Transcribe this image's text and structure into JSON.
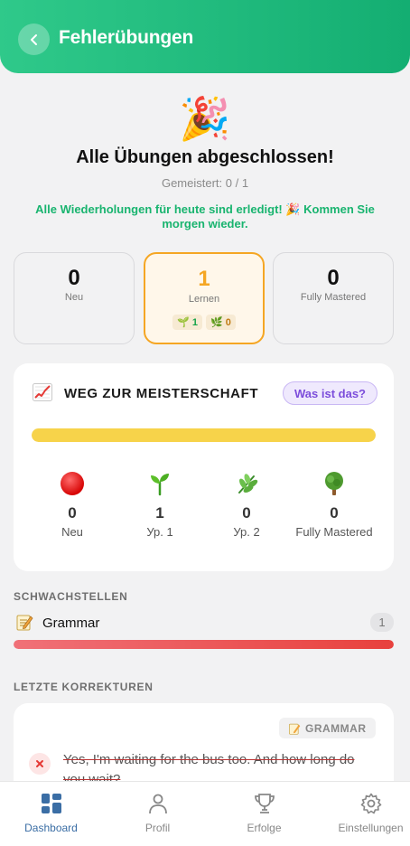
{
  "header": {
    "title": "Fehlerübungen",
    "back_icon": "chevron-left-icon"
  },
  "completion": {
    "emoji": "🎉",
    "title": "Alle Übungen abgeschlossen!",
    "mastered": "Gemeistert: 0 / 1",
    "message": "Alle Wiederholungen für heute sind erledigt! 🎉 Kommen Sie morgen wieder."
  },
  "stats": [
    {
      "value": "0",
      "label": "Neu"
    },
    {
      "value": "1",
      "label": "Lernen",
      "chips": [
        {
          "emoji": "🌱",
          "value": "1"
        },
        {
          "emoji": "🌿",
          "value": "0"
        }
      ]
    },
    {
      "value": "0",
      "label": "Fully Mastered"
    }
  ],
  "mastery_path": {
    "title": "WEG ZUR MEISTERSCHAFT",
    "help_button": "Was ist das?",
    "progress": 1.0,
    "progress_color": "#f7d34a",
    "stages": [
      {
        "icon": "red-circle-icon",
        "value": "0",
        "label": "Neu"
      },
      {
        "icon": "seedling-icon",
        "value": "1",
        "label": "Ур. 1"
      },
      {
        "icon": "herb-icon",
        "value": "0",
        "label": "Ур. 2"
      },
      {
        "icon": "tree-icon",
        "value": "0",
        "label": "Fully Mastered"
      }
    ]
  },
  "weak_spots": {
    "title": "SCHWACHSTELLEN",
    "items": [
      {
        "icon": "memo-icon",
        "name": "Grammar",
        "count": "1",
        "progress": 1.0
      }
    ]
  },
  "recent_corrections": {
    "title": "LETZTE KORREKTUREN",
    "items": [
      {
        "tag": "GRAMMAR",
        "text": "Yes, I'm waiting for the bus too. And how long do you wait?"
      }
    ]
  },
  "bottom_nav": [
    {
      "label": "Dashboard",
      "icon": "dashboard-grid-icon",
      "active": true
    },
    {
      "label": "Profil",
      "icon": "person-icon"
    },
    {
      "label": "Erfolge",
      "icon": "trophy-icon"
    },
    {
      "label": "Einstellungen",
      "icon": "gear-icon"
    }
  ]
}
